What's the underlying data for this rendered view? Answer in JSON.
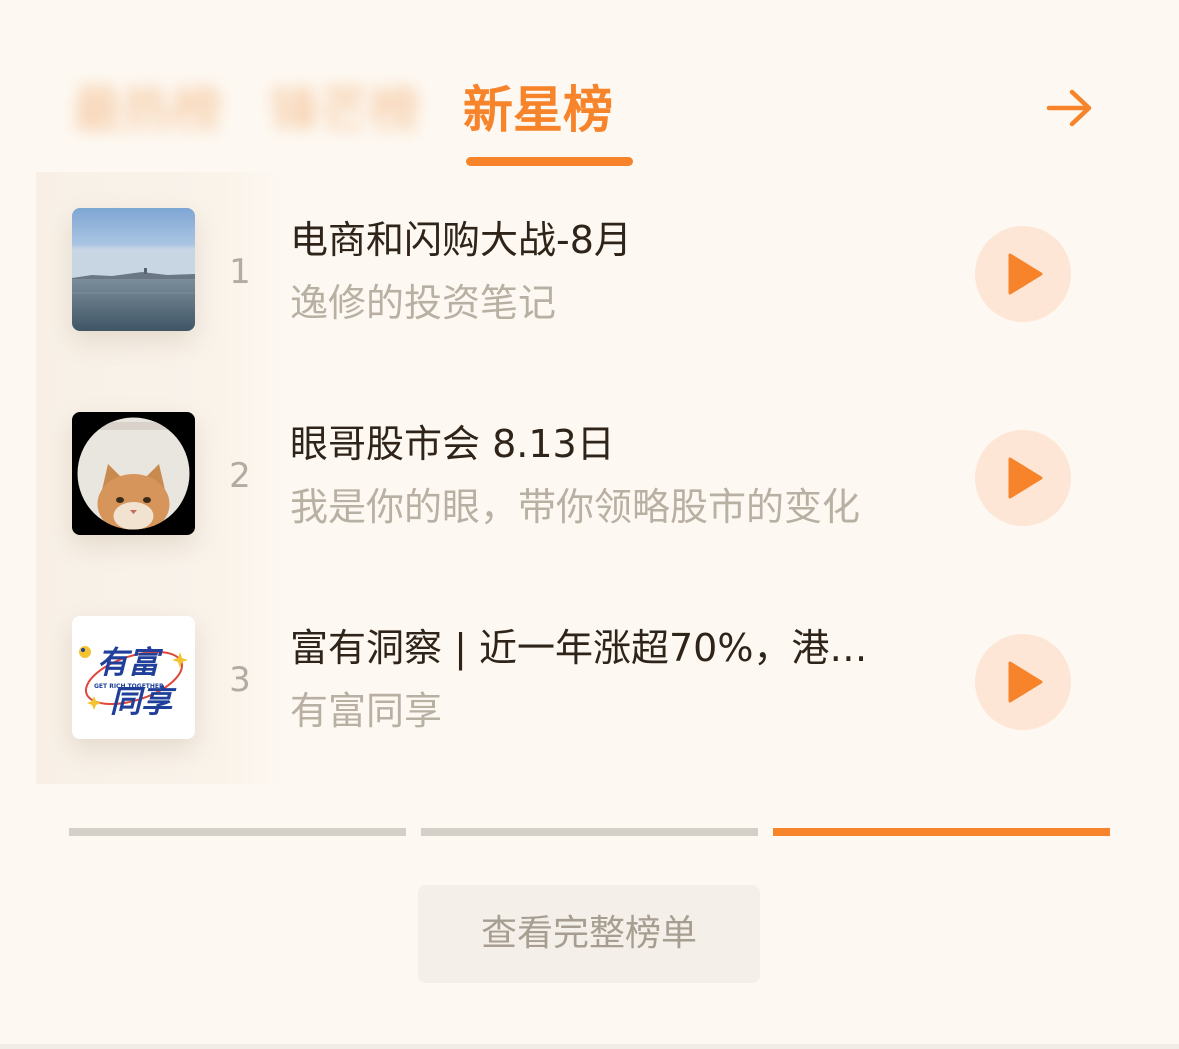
{
  "tabs": [
    {
      "label": "最热榜",
      "state": "inactive"
    },
    {
      "label": "锋芒榜",
      "state": "inactive"
    },
    {
      "label": "新星榜",
      "state": "active"
    }
  ],
  "header": {
    "arrow_icon": "arrow-right-icon"
  },
  "accent_color": "#f7842a",
  "items": [
    {
      "rank": "1",
      "title": "电商和闪购大战-8月",
      "subtitle": "逸修的投资笔记",
      "cover": "lake-photo",
      "play_icon": "play-icon"
    },
    {
      "rank": "2",
      "title": "眼哥股市会 8.13日",
      "subtitle": "我是你的眼，带你领略股市的变化",
      "cover": "cat-photo",
      "play_icon": "play-icon"
    },
    {
      "rank": "3",
      "title": "富有洞察 | 近一年涨超70%，港…",
      "subtitle": "有富同享",
      "cover": {
        "type": "logo",
        "lines": [
          "有富",
          "同享"
        ],
        "small_text": "GET RICH TOGETHER"
      },
      "play_icon": "play-icon"
    }
  ],
  "pager": {
    "pages": 3,
    "current": 3
  },
  "full_list_label": "查看完整榜单"
}
